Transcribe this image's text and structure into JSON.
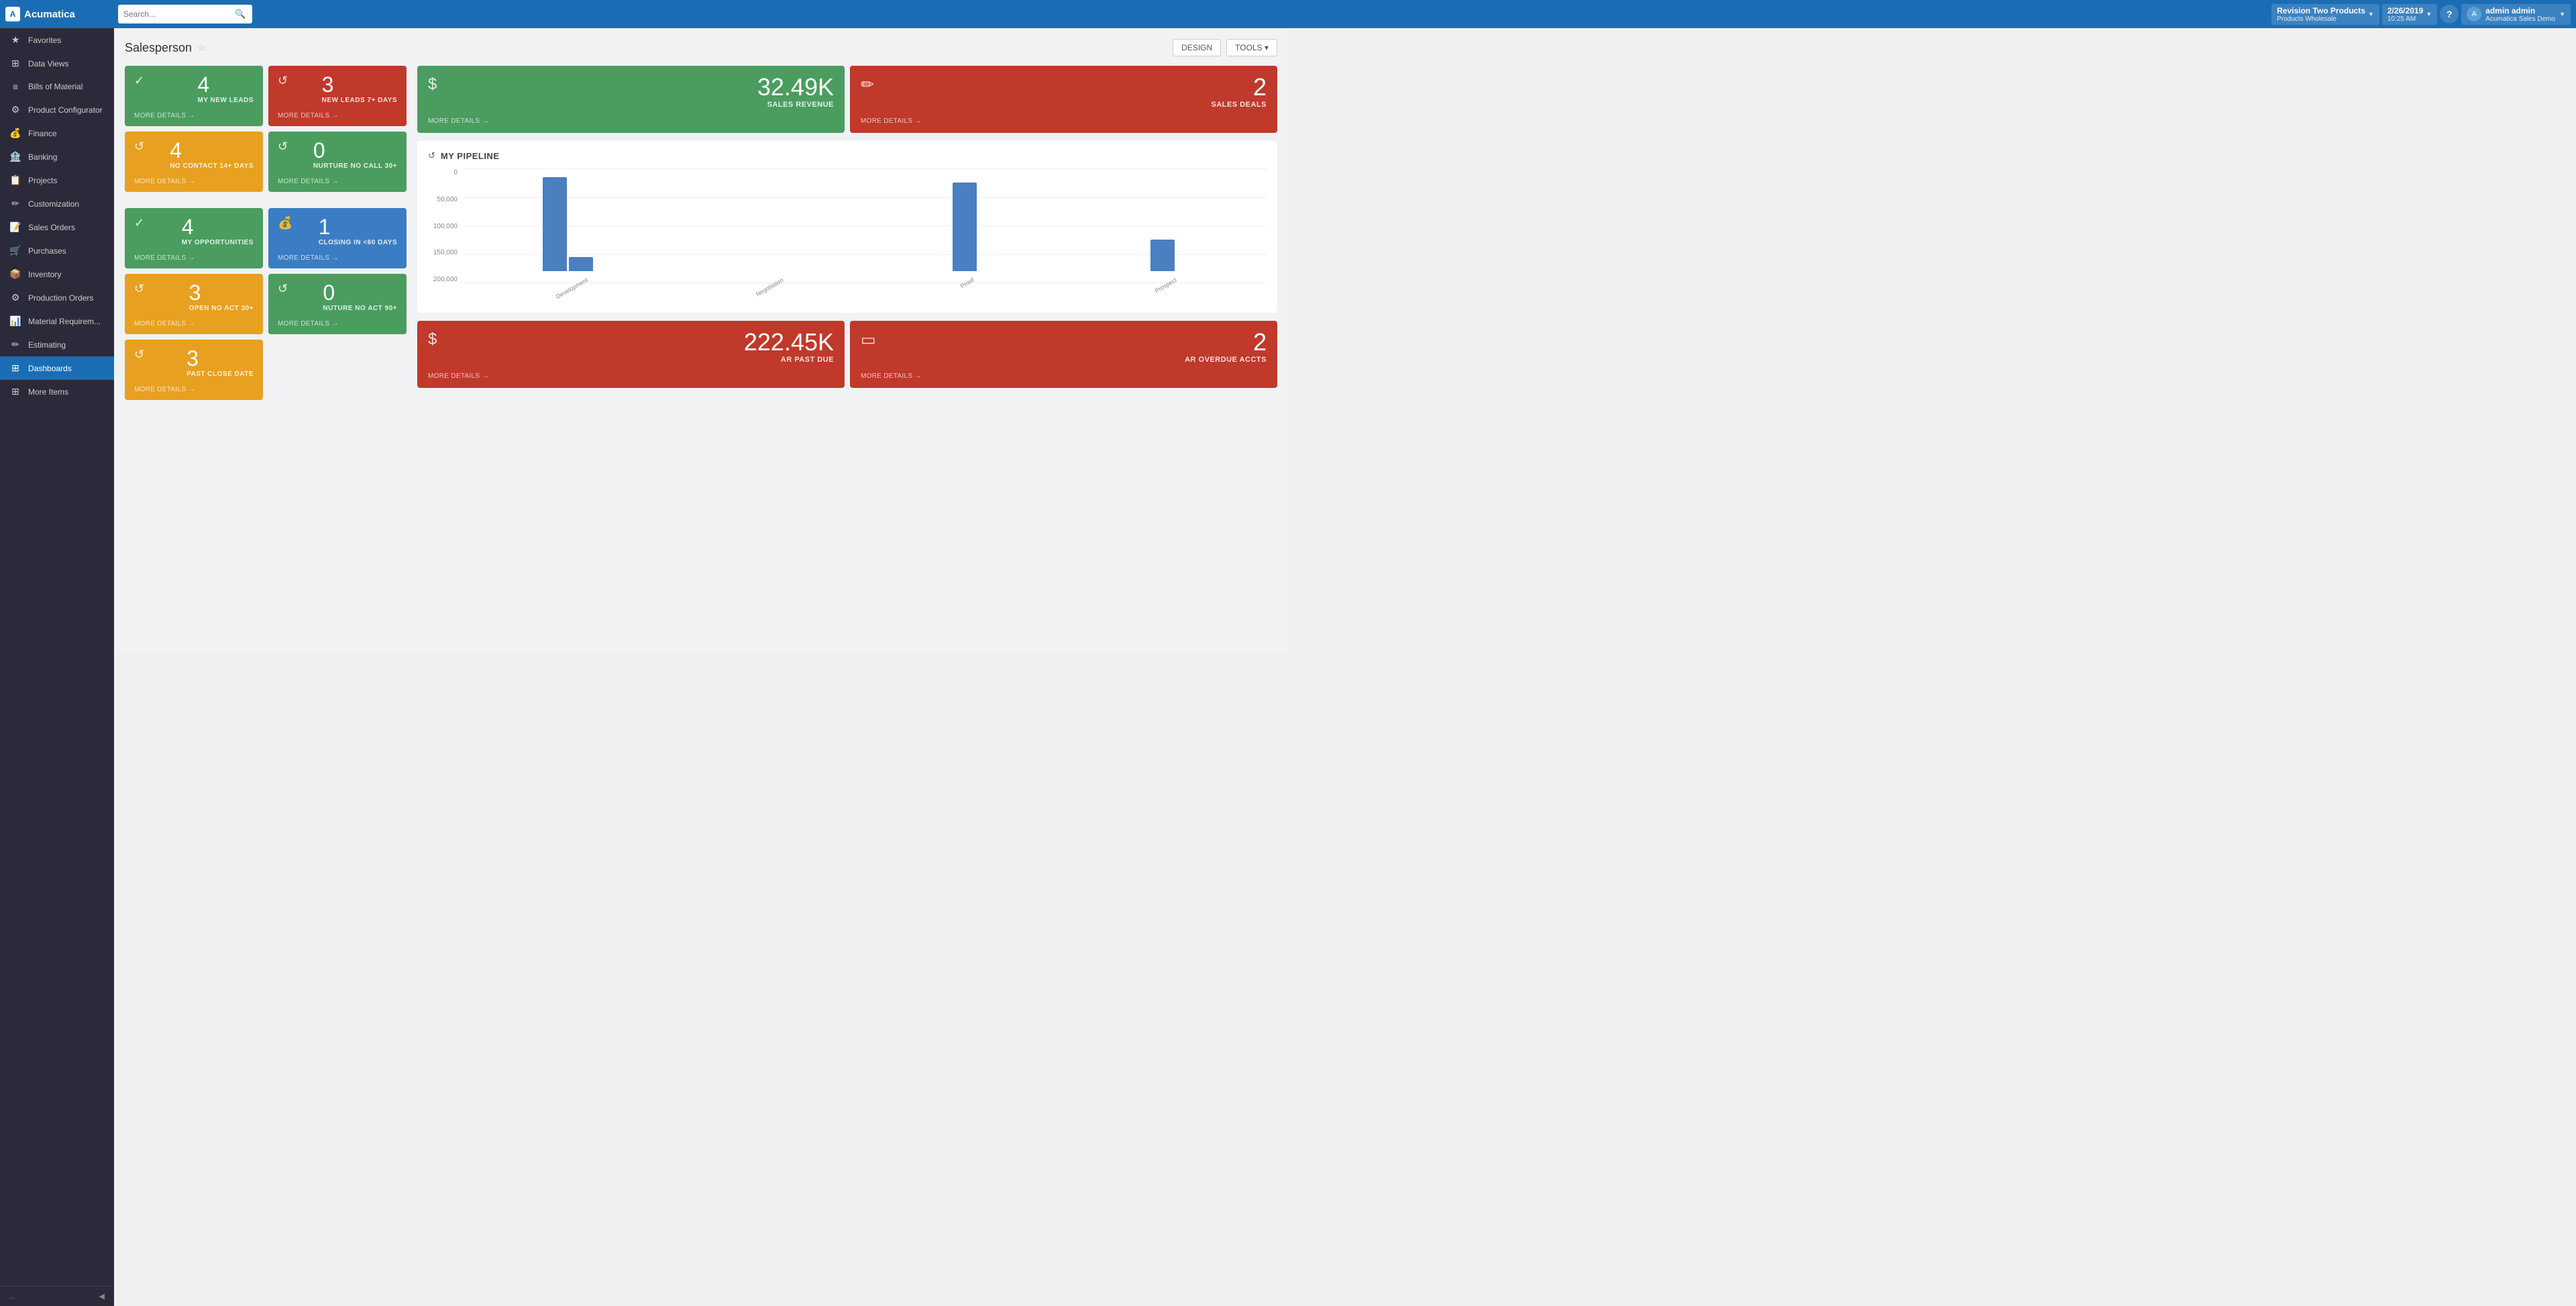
{
  "app": {
    "logo": "A",
    "name": "Acumatica"
  },
  "search": {
    "placeholder": "Search..."
  },
  "company": {
    "name": "Revision Two Products",
    "sub": "Products Wholesale",
    "chevron": "▼"
  },
  "datetime": {
    "date": "2/26/2019",
    "time": "10:25 AM",
    "chevron": "▼"
  },
  "user": {
    "name": "admin admin",
    "sub": "Acumatica Sales Demo",
    "chevron": "▼",
    "initials": "A"
  },
  "sidebar": {
    "items": [
      {
        "id": "favorites",
        "label": "Favorites",
        "icon": "★"
      },
      {
        "id": "data-views",
        "label": "Data Views",
        "icon": "⊞"
      },
      {
        "id": "bills-of-material",
        "label": "Bills of Material",
        "icon": "≡"
      },
      {
        "id": "product-configurator",
        "label": "Product Configurator",
        "icon": "⚙"
      },
      {
        "id": "finance",
        "label": "Finance",
        "icon": "💰"
      },
      {
        "id": "banking",
        "label": "Banking",
        "icon": "🏦"
      },
      {
        "id": "projects",
        "label": "Projects",
        "icon": "📋"
      },
      {
        "id": "customization",
        "label": "Customization",
        "icon": "✏"
      },
      {
        "id": "sales-orders",
        "label": "Sales Orders",
        "icon": "📝"
      },
      {
        "id": "purchases",
        "label": "Purchases",
        "icon": "🛒"
      },
      {
        "id": "inventory",
        "label": "Inventory",
        "icon": "📦"
      },
      {
        "id": "production-orders",
        "label": "Production Orders",
        "icon": "⚙"
      },
      {
        "id": "material-requirements",
        "label": "Material Requirem...",
        "icon": "📊"
      },
      {
        "id": "estimating",
        "label": "Estimating",
        "icon": "✏"
      },
      {
        "id": "dashboards",
        "label": "Dashboards",
        "icon": "⊞",
        "active": true
      },
      {
        "id": "more-items",
        "label": "More Items",
        "icon": "⊞"
      }
    ],
    "collapse_label": "...",
    "collapse_icon": "◀"
  },
  "page": {
    "title": "Salesperson",
    "star_icon": "☆",
    "design_btn": "DESIGN",
    "tools_btn": "TOOLS ▾"
  },
  "left_cards_row1": [
    {
      "id": "my-new-leads",
      "color": "green",
      "icon": "✓",
      "count": "4",
      "label": "MY NEW LEADS",
      "footer": "MORE DETAILS →"
    },
    {
      "id": "new-leads-7days",
      "color": "red",
      "icon": "↺",
      "count": "3",
      "label": "NEW LEADS 7+ DAYS",
      "footer": "MORE DETAILS →"
    }
  ],
  "left_cards_row2": [
    {
      "id": "no-contact-14days",
      "color": "yellow",
      "icon": "↺",
      "count": "4",
      "label": "NO CONTACT 14+ DAYS",
      "footer": "MORE DETAILS →"
    },
    {
      "id": "nurture-no-call-30",
      "color": "green",
      "icon": "↺",
      "count": "0",
      "label": "NURTURE NO CALL 30+",
      "footer": "MORE DETAILS →"
    }
  ],
  "left_cards_row3": [
    {
      "id": "my-opportunities",
      "color": "green",
      "icon": "✓",
      "count": "4",
      "label": "MY OPPORTUNITIES",
      "footer": "MORE DETAILS →"
    },
    {
      "id": "closing-60days",
      "color": "blue",
      "icon": "💰",
      "count": "1",
      "label": "CLOSING IN <60 DAYS",
      "footer": "MORE DETAILS →"
    }
  ],
  "left_cards_row4": [
    {
      "id": "open-no-act-30",
      "color": "yellow",
      "icon": "↺",
      "count": "3",
      "label": "OPEN NO ACT 30+",
      "footer": "MORE DETAILS →"
    },
    {
      "id": "nurture-no-act-90",
      "color": "green",
      "icon": "↺",
      "count": "0",
      "label": "NUTURE NO ACT 90+",
      "footer": "MORE DETAILS →"
    }
  ],
  "left_cards_row5": [
    {
      "id": "past-close-date",
      "color": "yellow",
      "icon": "↺",
      "count": "3",
      "label": "PAST CLOSE DATE",
      "footer": "MORE DETAILS →"
    }
  ],
  "right_top_cards": [
    {
      "id": "sales-revenue",
      "color": "green",
      "icon": "$",
      "count": "32.49K",
      "label": "SALES REVENUE",
      "footer": "MORE DETAILS →"
    },
    {
      "id": "sales-deals",
      "color": "red",
      "icon": "✏",
      "count": "2",
      "label": "SALES DEALS",
      "footer": "MORE DETAILS →"
    }
  ],
  "pipeline": {
    "title": "MY PIPELINE",
    "refresh_icon": "↺",
    "y_labels": [
      "200,000",
      "150,000",
      "100,000",
      "50,000",
      "0"
    ],
    "bars": [
      {
        "label": "Development",
        "value1": 165000,
        "value2": 25000
      },
      {
        "label": "Negotiation",
        "value1": 0,
        "value2": 0
      },
      {
        "label": "Proof",
        "value1": 155000,
        "value2": 0
      },
      {
        "label": "Prospect",
        "value1": 0,
        "value2": 55000
      }
    ],
    "max_value": 200000
  },
  "right_bottom_cards": [
    {
      "id": "ar-past-due",
      "color": "red",
      "icon": "$",
      "count": "222.45K",
      "label": "AR PAST DUE",
      "footer": "MORE DETAILS →"
    },
    {
      "id": "ar-overdue-accts",
      "color": "red",
      "icon": "▭",
      "count": "2",
      "label": "AR OVERDUE ACCTS",
      "footer": "MORE DETAILS →"
    }
  ]
}
